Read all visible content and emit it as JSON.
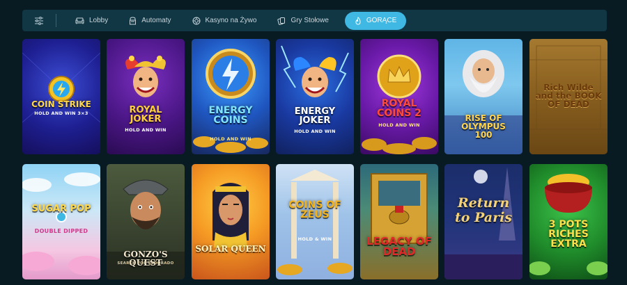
{
  "nav": {
    "tabs": [
      {
        "label": "Lobby",
        "icon": "sofa-icon"
      },
      {
        "label": "Automaty",
        "icon": "slot-machine-icon"
      },
      {
        "label": "Kasyno na Żywo",
        "icon": "roulette-chip-icon"
      },
      {
        "label": "Gry Stołowe",
        "icon": "playing-cards-icon"
      },
      {
        "label": "GORĄCE",
        "icon": "flame-icon",
        "active": true
      }
    ],
    "filter_icon": "sliders-icon",
    "colors": {
      "bar": "#113644",
      "active": "#3fb8e3",
      "text": "#c8d6dc"
    }
  },
  "games": {
    "row1": [
      {
        "title": "COIN STRIKE",
        "sub": "HOLD AND WIN 3×3"
      },
      {
        "title": "ROYAL JOKER",
        "sub": "HOLD AND WIN"
      },
      {
        "title": "ENERGY COINS",
        "sub": "HOLD AND WIN"
      },
      {
        "title": "ENERGY JOKER",
        "sub": "HOLD AND WIN"
      },
      {
        "title": "ROYAL COINS 2",
        "sub": "HOLD AND WIN"
      },
      {
        "title": "RISE OF OLYMPUS 100",
        "sub": ""
      },
      {
        "title": "Rich Wilde and the BOOK OF DEAD",
        "sub": ""
      }
    ],
    "row2": [
      {
        "title": "SUGAR POP",
        "sub": "DOUBLE DIPPED"
      },
      {
        "title": "GONZO'S QUEST",
        "sub": "SEARCH FOR ELDORADO"
      },
      {
        "title": "SOLAR QUEEN",
        "sub": ""
      },
      {
        "title": "COINS OF ZEUS",
        "sub": "HOLD & WIN"
      },
      {
        "title": "LEGACY OF DEAD",
        "sub": ""
      },
      {
        "title": "Return to Paris",
        "sub": ""
      },
      {
        "title": "3 POTS RICHES EXTRA",
        "sub": ""
      }
    ]
  }
}
